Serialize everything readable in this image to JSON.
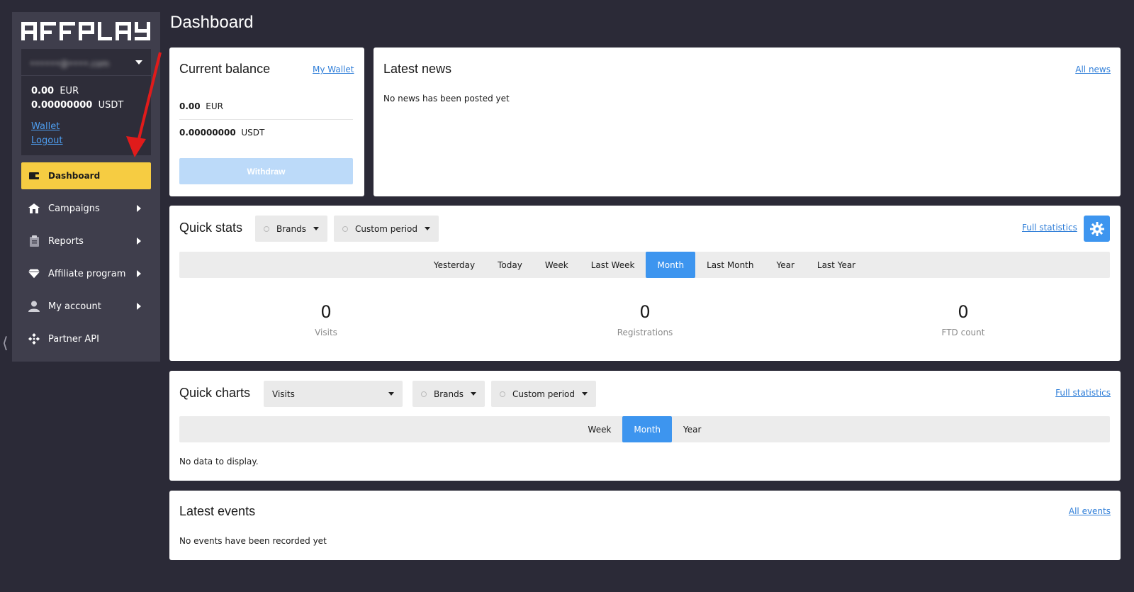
{
  "brand": {
    "logo_text": "AFFPLAY"
  },
  "account": {
    "email": "••••••@••••.com",
    "balances": [
      {
        "amount": "0.00",
        "currency": "EUR"
      },
      {
        "amount": "0.00000000",
        "currency": "USDT"
      }
    ],
    "wallet_label": "Wallet",
    "logout_label": "Logout"
  },
  "sidebar": {
    "items": [
      {
        "label": "Dashboard",
        "icon": "wallet-icon",
        "active": true
      },
      {
        "label": "Campaigns",
        "icon": "home-icon"
      },
      {
        "label": "Reports",
        "icon": "clipboard-icon"
      },
      {
        "label": "Affiliate program",
        "icon": "diamond-icon"
      },
      {
        "label": "My account",
        "icon": "user-icon"
      },
      {
        "label": "Partner API",
        "icon": "api-icon"
      }
    ]
  },
  "page": {
    "title": "Dashboard"
  },
  "balance_card": {
    "title": "Current balance",
    "wallet_link": "My Wallet",
    "rows": [
      {
        "amount": "0.00",
        "currency": "EUR"
      },
      {
        "amount": "0.00000000",
        "currency": "USDT"
      }
    ],
    "withdraw_label": "Withdraw"
  },
  "news_card": {
    "title": "Latest news",
    "all_link": "All news",
    "empty_text": "No news has been posted yet"
  },
  "quick_stats": {
    "title": "Quick stats",
    "brands_label": "Brands",
    "period_label": "Custom period",
    "full_link": "Full statistics",
    "tabs": [
      "Yesterday",
      "Today",
      "Week",
      "Last Week",
      "Month",
      "Last Month",
      "Year",
      "Last Year"
    ],
    "active_tab": "Month",
    "stats": [
      {
        "value": "0",
        "label": "Visits"
      },
      {
        "value": "0",
        "label": "Registrations"
      },
      {
        "value": "0",
        "label": "FTD count"
      }
    ]
  },
  "quick_charts": {
    "title": "Quick charts",
    "metric_label": "Visits",
    "brands_label": "Brands",
    "period_label": "Custom period",
    "full_link": "Full statistics",
    "tabs": [
      "Week",
      "Month",
      "Year"
    ],
    "active_tab": "Month",
    "empty_text": "No data to display."
  },
  "events_card": {
    "title": "Latest events",
    "all_link": "All events",
    "empty_text": "No events have been recorded yet"
  },
  "colors": {
    "background": "#2b2a37",
    "sidebar": "#3f3e4c",
    "active_nav": "#f6cc42",
    "accent_blue": "#3d95ef",
    "link": "#2f7ed8"
  }
}
